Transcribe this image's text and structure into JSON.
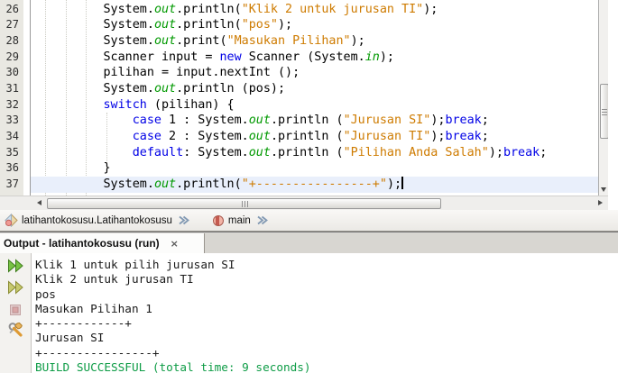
{
  "colors": {
    "keyword": "#0000E6",
    "string": "#CE7B00",
    "field": "#009900",
    "success_text": "#0E9C46",
    "current_line_highlight": "#E9EFFB",
    "gutter_background": "#E9E8E2"
  },
  "editor": {
    "lines": [
      {
        "num": 26,
        "current": false,
        "tokens": [
          {
            "t": "        System.",
            "c": "p"
          },
          {
            "t": "out",
            "c": "f"
          },
          {
            "t": ".println(",
            "c": "p"
          },
          {
            "t": "\"Klik 2 untuk jurusan TI\"",
            "c": "s"
          },
          {
            "t": ");",
            "c": "p"
          }
        ]
      },
      {
        "num": 27,
        "current": false,
        "tokens": [
          {
            "t": "        System.",
            "c": "p"
          },
          {
            "t": "out",
            "c": "f"
          },
          {
            "t": ".println(",
            "c": "p"
          },
          {
            "t": "\"pos\"",
            "c": "s"
          },
          {
            "t": ");",
            "c": "p"
          }
        ]
      },
      {
        "num": 28,
        "current": false,
        "tokens": [
          {
            "t": "        System.",
            "c": "p"
          },
          {
            "t": "out",
            "c": "f"
          },
          {
            "t": ".print(",
            "c": "p"
          },
          {
            "t": "\"Masukan Pilihan\"",
            "c": "s"
          },
          {
            "t": ");",
            "c": "p"
          }
        ]
      },
      {
        "num": 29,
        "current": false,
        "tokens": [
          {
            "t": "        Scanner input = ",
            "c": "p"
          },
          {
            "t": "new",
            "c": "k"
          },
          {
            "t": " Scanner (System.",
            "c": "p"
          },
          {
            "t": "in",
            "c": "f"
          },
          {
            "t": ");",
            "c": "p"
          }
        ]
      },
      {
        "num": 30,
        "current": false,
        "tokens": [
          {
            "t": "        pilihan = input.nextInt ();",
            "c": "p"
          }
        ]
      },
      {
        "num": 31,
        "current": false,
        "tokens": [
          {
            "t": "        System.",
            "c": "p"
          },
          {
            "t": "out",
            "c": "f"
          },
          {
            "t": ".println (pos);",
            "c": "p"
          }
        ]
      },
      {
        "num": 32,
        "current": false,
        "tokens": [
          {
            "t": "        ",
            "c": "p"
          },
          {
            "t": "switch",
            "c": "k"
          },
          {
            "t": " (pilihan) {",
            "c": "p"
          }
        ]
      },
      {
        "num": 33,
        "current": false,
        "tokens": [
          {
            "t": "            ",
            "c": "p"
          },
          {
            "t": "case",
            "c": "k"
          },
          {
            "t": " 1 : System.",
            "c": "p"
          },
          {
            "t": "out",
            "c": "f"
          },
          {
            "t": ".println (",
            "c": "p"
          },
          {
            "t": "\"Jurusan SI\"",
            "c": "s"
          },
          {
            "t": ");",
            "c": "p"
          },
          {
            "t": "break",
            "c": "k"
          },
          {
            "t": ";",
            "c": "p"
          }
        ]
      },
      {
        "num": 34,
        "current": false,
        "tokens": [
          {
            "t": "            ",
            "c": "p"
          },
          {
            "t": "case",
            "c": "k"
          },
          {
            "t": " 2 : System.",
            "c": "p"
          },
          {
            "t": "out",
            "c": "f"
          },
          {
            "t": ".println (",
            "c": "p"
          },
          {
            "t": "\"Jurusan TI\"",
            "c": "s"
          },
          {
            "t": ");",
            "c": "p"
          },
          {
            "t": "break",
            "c": "k"
          },
          {
            "t": ";",
            "c": "p"
          }
        ]
      },
      {
        "num": 35,
        "current": false,
        "tokens": [
          {
            "t": "            ",
            "c": "p"
          },
          {
            "t": "default",
            "c": "k"
          },
          {
            "t": ": System.",
            "c": "p"
          },
          {
            "t": "out",
            "c": "f"
          },
          {
            "t": ".println (",
            "c": "p"
          },
          {
            "t": "\"Pilihan Anda Salah\"",
            "c": "s"
          },
          {
            "t": ");",
            "c": "p"
          },
          {
            "t": "break",
            "c": "k"
          },
          {
            "t": ";",
            "c": "p"
          }
        ]
      },
      {
        "num": 36,
        "current": false,
        "tokens": [
          {
            "t": "        }",
            "c": "p"
          }
        ]
      },
      {
        "num": 37,
        "current": true,
        "tokens": [
          {
            "t": "        System.",
            "c": "p"
          },
          {
            "t": "out",
            "c": "f"
          },
          {
            "t": ".println(",
            "c": "p"
          },
          {
            "t": "\"+----------------+\"",
            "c": "s"
          },
          {
            "t": ");",
            "c": "p"
          }
        ]
      }
    ]
  },
  "breadcrumb": {
    "items": [
      {
        "label": "latihantokosusu.Latihantokosusu",
        "icon": "class-icon"
      },
      {
        "label": "main",
        "icon": "method-icon"
      }
    ],
    "chevron_icon": "chevron-double-icon"
  },
  "output": {
    "tab_title": "Output - latihantokosusu (run)",
    "close_glyph": "×",
    "toolbar_icons": [
      {
        "name": "rerun-icon"
      },
      {
        "name": "rerun-alt-icon"
      },
      {
        "name": "stop-icon"
      },
      {
        "name": "build-settings-icon"
      }
    ],
    "lines": [
      {
        "text": "Klik 1 untuk pilih jurusan SI",
        "kind": "default"
      },
      {
        "text": "Klik 2 untuk jurusan TI",
        "kind": "default"
      },
      {
        "text": "pos",
        "kind": "default"
      },
      {
        "text": "Masukan Pilihan 1",
        "kind": "default"
      },
      {
        "text": "+------------+",
        "kind": "default"
      },
      {
        "text": "Jurusan SI",
        "kind": "default"
      },
      {
        "text": "+----------------+",
        "kind": "default"
      },
      {
        "text": "BUILD SUCCESSFUL (total time: 9 seconds)",
        "kind": "success"
      }
    ]
  }
}
